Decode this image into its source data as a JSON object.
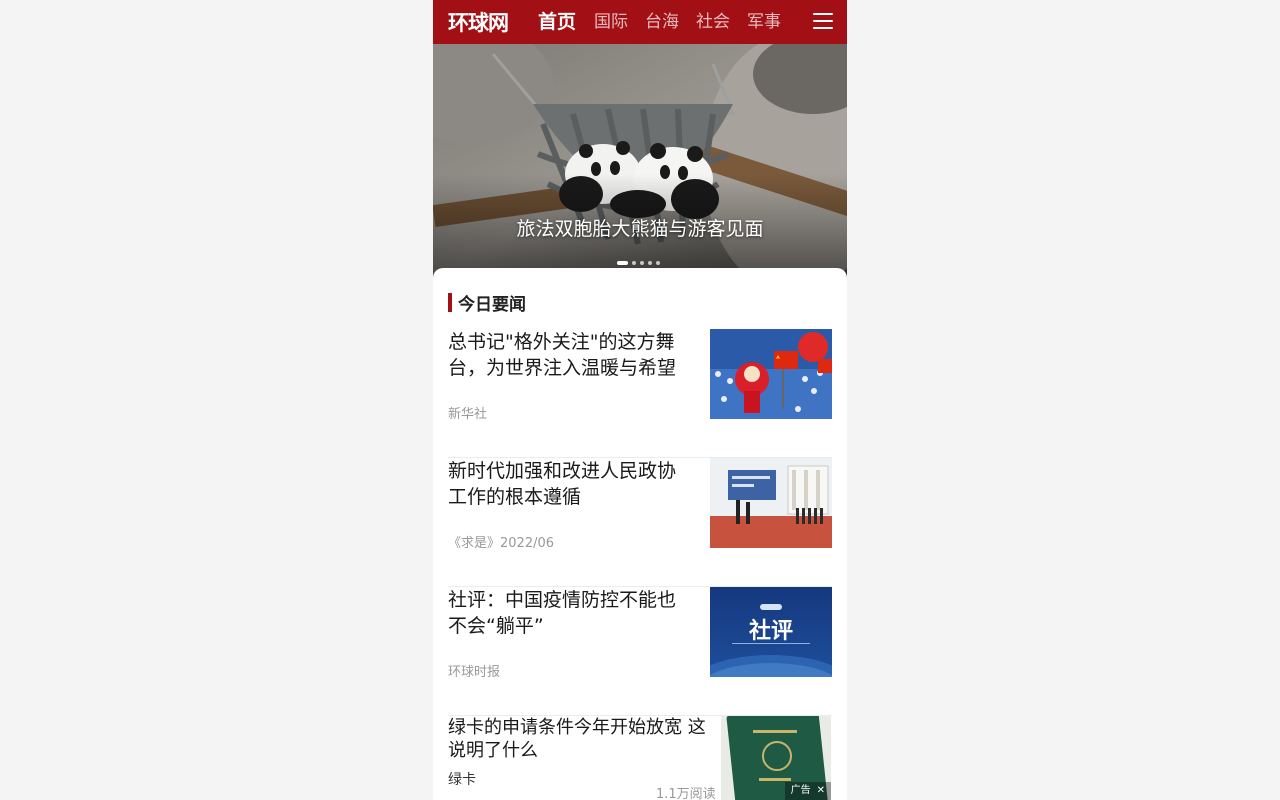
{
  "header": {
    "logo": "环球网",
    "nav": [
      "首页",
      "国际",
      "台海",
      "社会",
      "军事"
    ],
    "menu_icon": "hamburger-menu-icon"
  },
  "hero": {
    "caption": "旅法双胞胎大熊猫与游客见面",
    "slide_count": 5,
    "active_slide": 1
  },
  "section": {
    "title": "今日要闻"
  },
  "news": [
    {
      "title": "总书记\"格外关注\"的这方舞台，为世界注入温暖与希望",
      "source": "新华社"
    },
    {
      "title": "新时代加强和改进人民政协工作的根本遵循",
      "source": "《求是》2022/06"
    },
    {
      "title": "社评：中国疫情防控不能也不会“躺平”",
      "source": "环球时报"
    }
  ],
  "ad": {
    "title": "绿卡的申请条件今年开始放宽 这说明了什么",
    "tag": "绿卡",
    "reads": "1.1万阅读",
    "badge": "广告",
    "close": "✕"
  },
  "thumb_text": {
    "editorial": "社评"
  },
  "colors": {
    "brand": "#a20f14",
    "background": "#f4f4f4"
  }
}
